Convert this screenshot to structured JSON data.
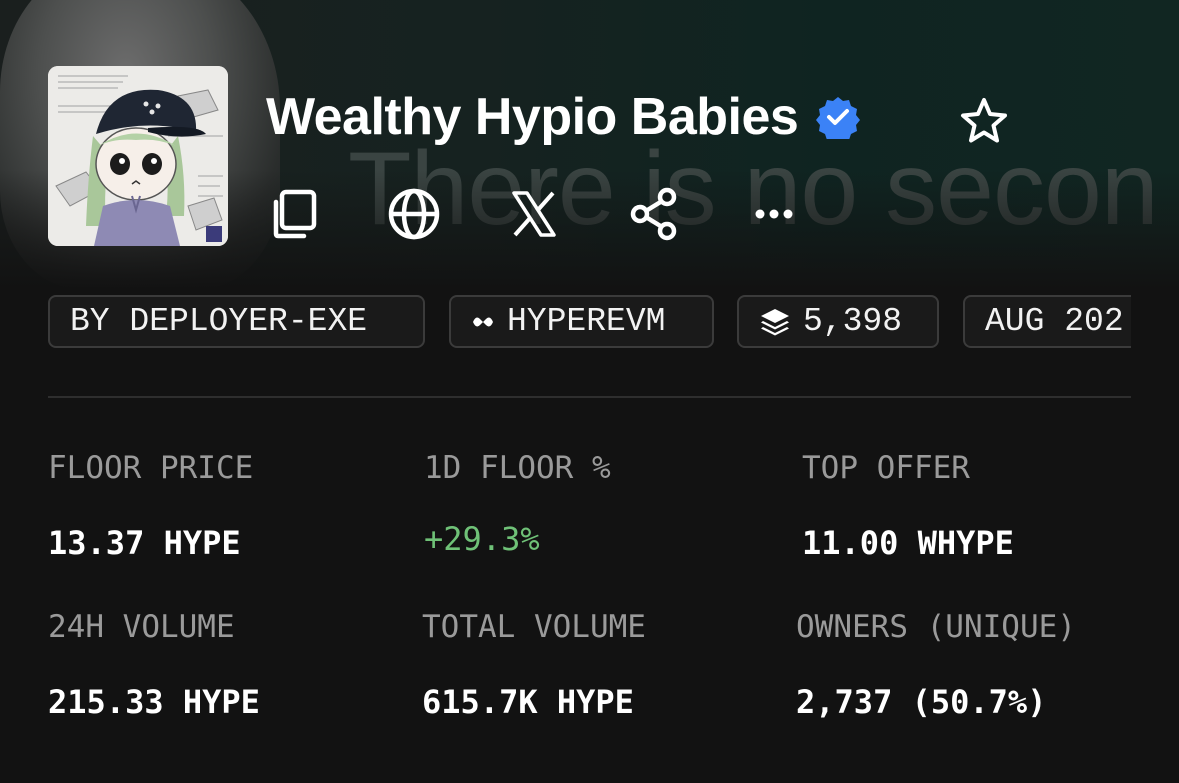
{
  "banner": {
    "text": "There is no secon"
  },
  "collection": {
    "name": "Wealthy Hypio Babies",
    "verified_icon": "verified-badge-icon",
    "favorite_icon": "star-outline-icon"
  },
  "actions": [
    {
      "icon": "copy-icon"
    },
    {
      "icon": "globe-icon"
    },
    {
      "icon": "x-logo-icon"
    },
    {
      "icon": "share-icon"
    },
    {
      "icon": "more-icon"
    }
  ],
  "tags": {
    "creator": "BY DEPLOYER-EXE",
    "chain": "HYPEREVM",
    "supply": "5,398",
    "date": "AUG 202"
  },
  "stats": {
    "floor_price": {
      "label": "FLOOR PRICE",
      "value": "13.37 HYPE"
    },
    "floor_change": {
      "label": "1D FLOOR %",
      "value": "+29.3%"
    },
    "top_offer": {
      "label": "TOP OFFER",
      "value": "11.00 WHYPE"
    },
    "volume_24h": {
      "label": "24H VOLUME",
      "value": "215.33 HYPE"
    },
    "total_volume": {
      "label": "TOTAL VOLUME",
      "value": "615.7K HYPE"
    },
    "owners": {
      "label": "OWNERS (UNIQUE)",
      "value": "2,737 (50.7%)"
    }
  },
  "colors": {
    "background": "#121212",
    "positive": "#6fc177",
    "verified": "#3b82f6",
    "label": "#9a9a9a"
  }
}
